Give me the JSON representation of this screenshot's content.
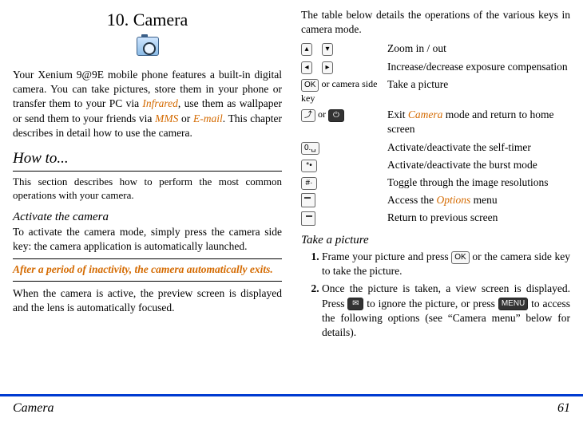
{
  "chapter_title": "10. Camera",
  "intro_before_link1": "Your Xenium 9@9E mobile phone features a built-in digital camera. You can take pictures, store them in your phone or transfer them to your PC via ",
  "link_infrared": "Infrared",
  "intro_mid1": ", use them as wallpaper or send them to your friends via ",
  "link_mms": "MMS",
  "intro_mid_or": " or ",
  "link_email": "E-mail",
  "intro_after": ". This chapter describes in detail how to use the camera.",
  "howto_heading": "How to...",
  "howto_sub": "This section describes how to perform the most common operations with your camera.",
  "activate_heading": "Activate the camera",
  "activate_body": "To activate the camera mode, simply press the camera side key: the camera application is automatically launched.",
  "activate_note": "After a period of inactivity, the camera automatically exits.",
  "activate_after": "When the camera is active, the preview screen is displayed and the lens is automatically focused.",
  "right_intro": "The table below details the operations of the various keys in camera mode.",
  "keys": {
    "zoom": "Zoom in / out",
    "exposure": "Increase/decrease exposure compensation",
    "take_label_pre": " or camera side key",
    "take": "Take a picture",
    "exit_or": " or ",
    "exit": "Exit ",
    "exit_link": "Camera",
    "exit_after": " mode and return to home screen",
    "selftimer": "Activate/deactivate the self-timer",
    "burst": "Activate/deactivate the burst mode",
    "resolution": "Toggle through the image resolutions",
    "options_pre": "Access the ",
    "options_link": "Options",
    "options_post": " menu",
    "return": "Return to previous screen"
  },
  "take_heading": "Take a picture",
  "step1_a": "Frame your picture and press ",
  "step1_b": " or the camera side key to take the picture.",
  "step2_a": "Once the picture is taken, a view screen is displayed. Press ",
  "step2_b": " to ignore the picture, or press ",
  "step2_c": " to access the following options (see “Camera menu” below for details).",
  "sym_ok": "OK",
  "sym_back": "⤴",
  "sym_zero": "0.␣",
  "sym_star": "*•",
  "sym_hash": "#·",
  "sym_menu": "MENU",
  "footer_left": "Camera",
  "footer_right": "61"
}
